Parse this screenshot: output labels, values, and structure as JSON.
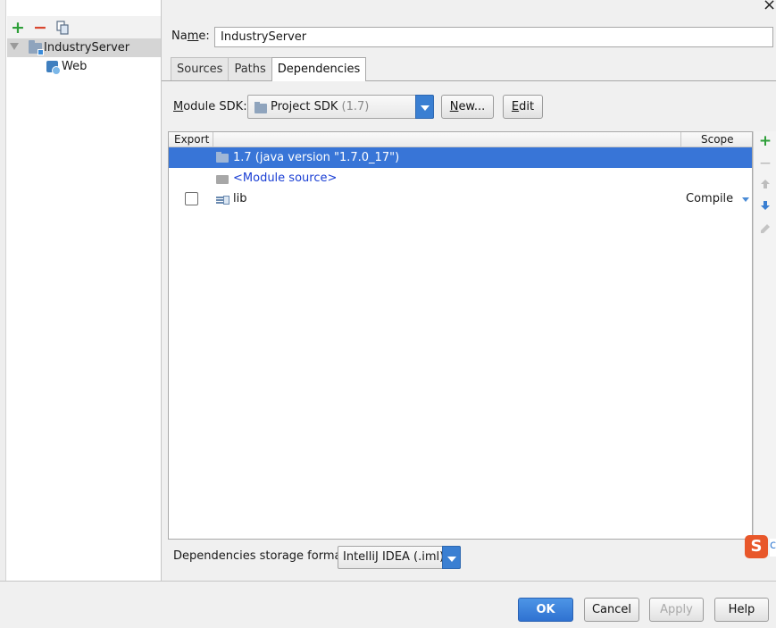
{
  "left": {
    "toolbar": {
      "add_icon": "+",
      "remove_icon": "−",
      "copy_icon": "copy-icon"
    },
    "tree": [
      {
        "label": "IndustryServer",
        "selected": true
      },
      {
        "label": "Web",
        "selected": false
      }
    ]
  },
  "name": {
    "label_pre": "Na",
    "label_underlined": "m",
    "label_post": "e:",
    "value": "IndustryServer"
  },
  "tabs": [
    {
      "label": "Sources",
      "active": false
    },
    {
      "label": "Paths",
      "active": false
    },
    {
      "label": "Dependencies",
      "active": true
    }
  ],
  "sdk": {
    "label_underlined": "M",
    "label_rest": "odule SDK:",
    "selected": "Project SDK",
    "selected_sub": "(1.7)",
    "new_underlined": "N",
    "new_rest": "ew...",
    "edit_underlined": "E",
    "edit_rest": "dit"
  },
  "dependencies": {
    "columns": {
      "export": "Export",
      "scope": "Scope"
    },
    "rows": [
      {
        "text": "1.7 (java version \"1.7.0_17\")",
        "selected": true,
        "has_checkbox": false,
        "scope": ""
      },
      {
        "text": "<Module source>",
        "selected": false,
        "has_checkbox": false,
        "scope": ""
      },
      {
        "text": "lib",
        "selected": false,
        "has_checkbox": true,
        "checked": false,
        "scope": "Compile"
      }
    ]
  },
  "storage": {
    "label": "Dependencies storage format:",
    "selected": "IntelliJ IDEA (.iml)"
  },
  "ime": {
    "glyph": "S",
    "edge_text": "c"
  },
  "dialog": {
    "close": "×",
    "ok": "OK",
    "cancel": "Cancel",
    "apply": "Apply",
    "help": "Help"
  },
  "colors": {
    "selection": "#3875d7",
    "accent": "#3a7fd2",
    "add_green": "#2e9f39",
    "remove_red": "#d9472f"
  }
}
